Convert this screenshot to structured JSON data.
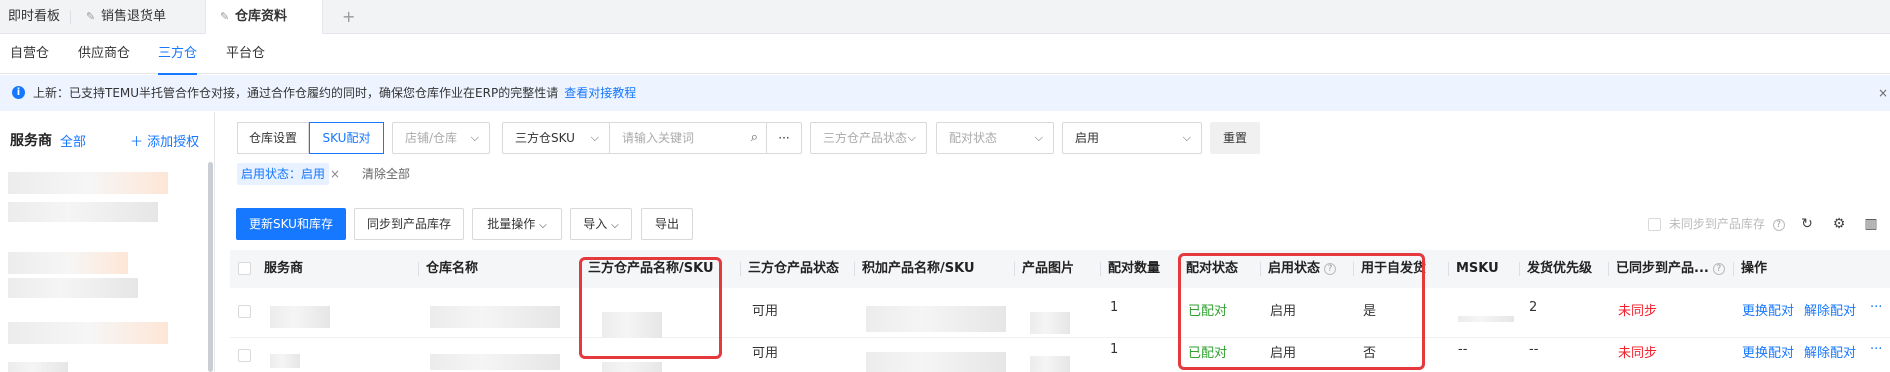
{
  "top_tabs": [
    {
      "label": "即时看板"
    },
    {
      "label": "销售退货单"
    },
    {
      "label": "仓库资料"
    }
  ],
  "sub_tabs": [
    {
      "label": "自营仓"
    },
    {
      "label": "供应商仓"
    },
    {
      "label": "三方仓"
    },
    {
      "label": "平台仓"
    }
  ],
  "notice": {
    "text": "上新：已支持TEMU半托管合作仓对接，通过合作仓履约的同时，确保您仓库作业在ERP的完整性请",
    "link": "查看对接教程"
  },
  "sidebar": {
    "title": "服务商",
    "all_label": "全部",
    "add_label": "添加授权"
  },
  "filters": {
    "tab_warehouse_settings": "仓库设置",
    "tab_sku_match": "SKU配对",
    "store_warehouse_placeholder": "店铺/仓库",
    "search_type": "三方仓SKU",
    "search_placeholder": "请输入关键词",
    "more": "···",
    "product_status_placeholder": "三方仓产品状态",
    "match_status_placeholder": "配对状态",
    "enable_value": "启用",
    "reset": "重置"
  },
  "active_filter": {
    "chip": "启用状态：启用",
    "clear_all": "清除全部"
  },
  "actions": {
    "update_sku_stock": "更新SKU和库存",
    "sync_to_stock": "同步到产品库存",
    "batch_ops": "批量操作",
    "import": "导入",
    "export": "导出",
    "unsynced_label": "未同步到产品库存"
  },
  "table": {
    "columns": {
      "provider": "服务商",
      "warehouse": "仓库名称",
      "tp_name_sku": "三方仓产品名称/SKU",
      "tp_status": "三方仓产品状态",
      "jijia_name_sku": "积加产品名称/SKU",
      "image": "产品图片",
      "match_qty": "配对数量",
      "match_status": "配对状态",
      "enable_status": "启用状态",
      "self_ship": "用于自发货",
      "msku": "MSKU",
      "priority": "发货优先级",
      "synced": "已同步到产品...",
      "ops": "操作"
    },
    "rows": [
      {
        "tp_status": "可用",
        "match_qty": "1",
        "match_status": "已配对",
        "enable_status": "启用",
        "self_ship": "是",
        "msku": "",
        "priority": "2",
        "synced": "未同步",
        "op_change": "更换配对",
        "op_unbind": "解除配对",
        "op_more": "···"
      },
      {
        "tp_status": "可用",
        "match_qty": "1",
        "match_status": "已配对",
        "enable_status": "启用",
        "self_ship": "否",
        "msku": "--",
        "priority": "--",
        "synced": "未同步",
        "op_change": "更换配对",
        "op_unbind": "解除配对",
        "op_more": "···"
      }
    ]
  },
  "colors": {
    "accent": "#1677ff",
    "success": "#2ea12e",
    "danger": "#f5222d",
    "highlight": "#e5393d"
  }
}
